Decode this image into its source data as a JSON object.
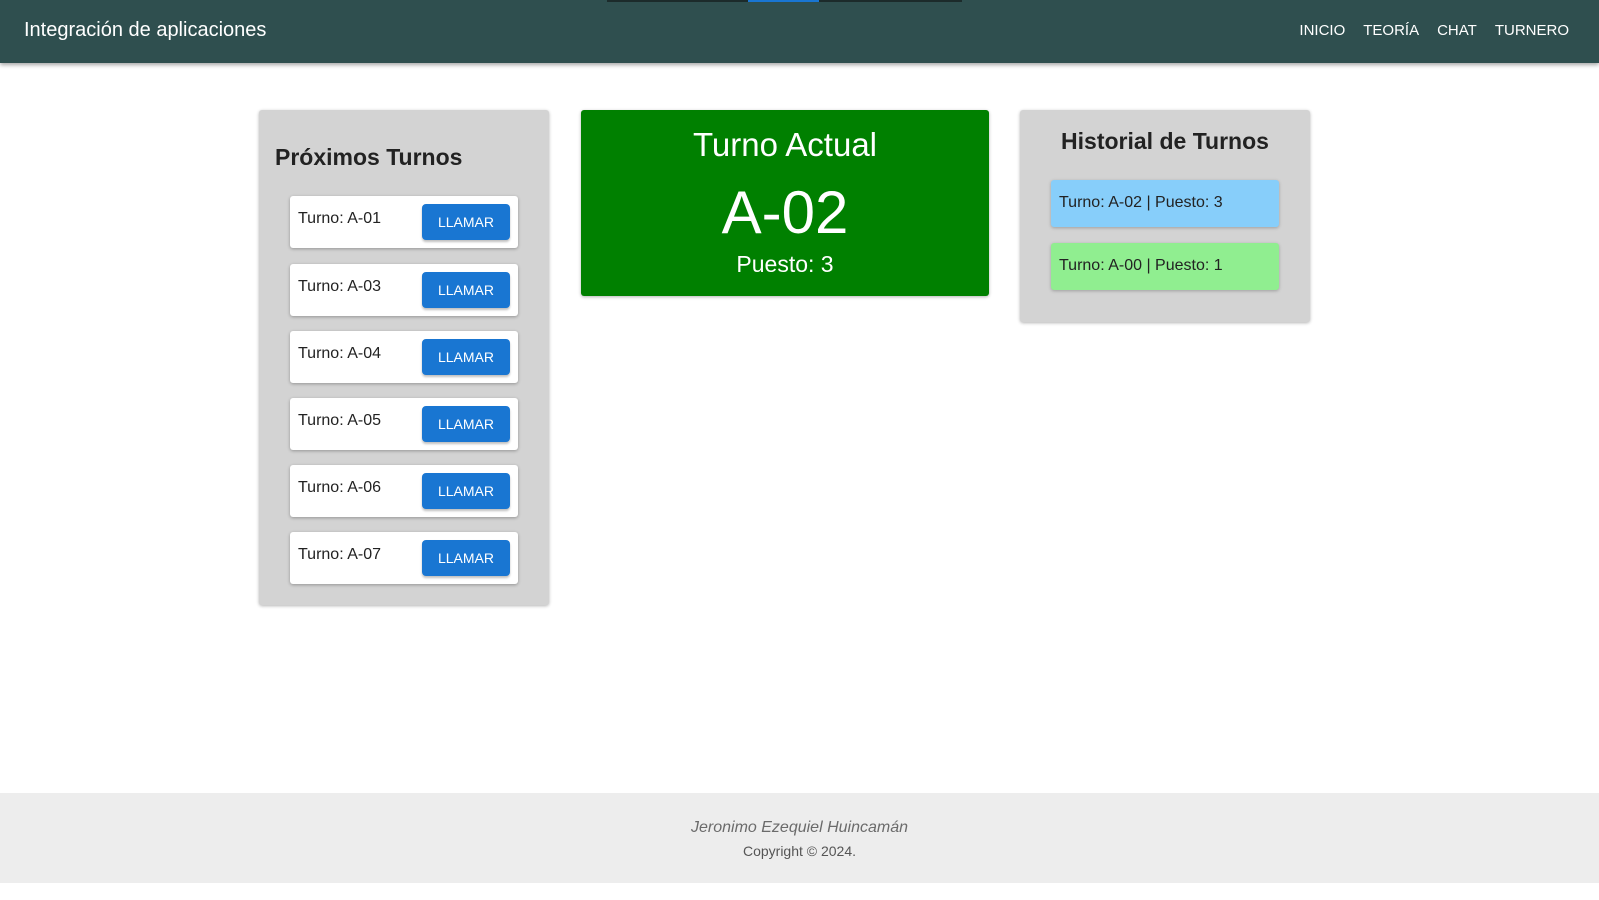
{
  "appbar": {
    "title": "Integración de aplicaciones",
    "nav": [
      "INICIO",
      "TEORÍA",
      "CHAT",
      "TURNERO"
    ],
    "color": "#2f4f4f"
  },
  "upcoming": {
    "title": "Próximos Turnos",
    "items": [
      {
        "label": "Turno: A-01",
        "button": "LLAMAR"
      },
      {
        "label": "Turno: A-03",
        "button": "LLAMAR"
      },
      {
        "label": "Turno: A-04",
        "button": "LLAMAR"
      },
      {
        "label": "Turno: A-05",
        "button": "LLAMAR"
      },
      {
        "label": "Turno: A-06",
        "button": "LLAMAR"
      },
      {
        "label": "Turno: A-07",
        "button": "LLAMAR"
      }
    ]
  },
  "current": {
    "title": "Turno Actual",
    "number": "A-02",
    "station": "Puesto: 3",
    "color": "#008000"
  },
  "history": {
    "title": "Historial de Turnos",
    "items": [
      {
        "label": "Turno: A-02 | Puesto: 3",
        "color": "#87cefa"
      },
      {
        "label": "Turno: A-00 | Puesto: 1",
        "color": "#90ee90"
      }
    ]
  },
  "footer": {
    "author": "Jeronimo Ezequiel Huincamán",
    "copyright": "Copyright © 2024."
  }
}
